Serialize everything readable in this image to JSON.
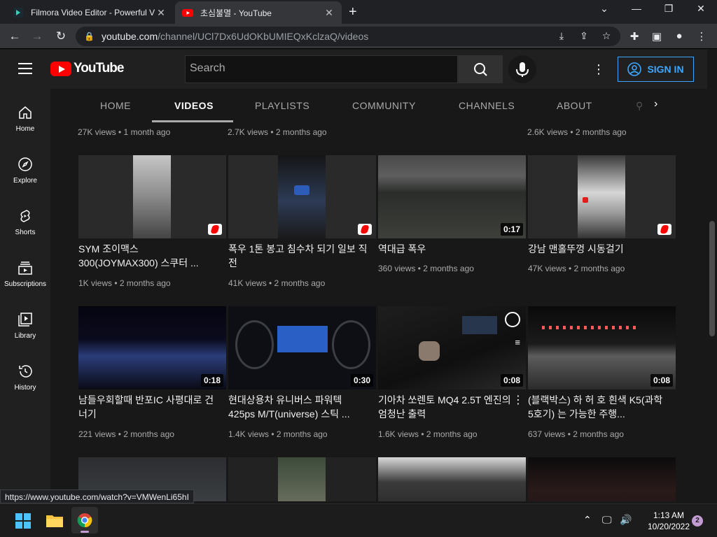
{
  "browser": {
    "tabs": [
      {
        "title": "Filmora Video Editor - Powerful V",
        "icon": "filmora-icon"
      },
      {
        "title": "초심불멸 - YouTube",
        "icon": "youtube-icon"
      }
    ],
    "url_host": "youtube.com",
    "url_path": "/channel/UCl7Dx6UdOKbUMIEQxKclzaQ/videos"
  },
  "header": {
    "logo_text": "YouTube",
    "search_placeholder": "Search",
    "signin_label": "SIGN IN"
  },
  "sidebar": {
    "items": [
      {
        "label": "Home",
        "icon": "home-icon"
      },
      {
        "label": "Explore",
        "icon": "compass-icon"
      },
      {
        "label": "Shorts",
        "icon": "shorts-icon"
      },
      {
        "label": "Subscriptions",
        "icon": "subscriptions-icon"
      },
      {
        "label": "Library",
        "icon": "library-icon"
      },
      {
        "label": "History",
        "icon": "history-icon"
      }
    ]
  },
  "channel_tabs": [
    "HOME",
    "VIDEOS",
    "PLAYLISTS",
    "COMMUNITY",
    "CHANNELS",
    "ABOUT"
  ],
  "top_meta": [
    "27K views • 1 month ago",
    "2.7K views • 2 months ago",
    "",
    "2.6K views • 2 months ago"
  ],
  "row1": [
    {
      "title": "SYM 조이맥스 300(JOYMAX300) 스쿠터 ...",
      "meta": "1K views • 2 months ago",
      "short": true,
      "duration": ""
    },
    {
      "title": "폭우 1톤 봉고 침수차 되기 일보 직전",
      "meta": "41K views • 2 months ago",
      "short": true,
      "duration": ""
    },
    {
      "title": "역대급 폭우",
      "meta": "360 views • 2 months ago",
      "short": false,
      "duration": "0:17"
    },
    {
      "title": "강남 맨홀뚜껑 시동걸기",
      "meta": "47K views • 2 months ago",
      "short": true,
      "duration": ""
    }
  ],
  "row2": [
    {
      "title": "남들우회할때 반포IC 사평대로 건너기",
      "meta": "221 views • 2 months ago",
      "duration": "0:18"
    },
    {
      "title": "현대상용차 유니버스 파워텍 425ps M/T(universe) 스틱 ...",
      "meta": "1.4K views • 2 months ago",
      "duration": "0:30"
    },
    {
      "title": "기아차 쏘렌토 MQ4 2.5T 엔진의 엄청난 출력",
      "meta": "1.6K views • 2 months ago",
      "duration": "0:08"
    },
    {
      "title": "(블랙박스) 하 허 호 흰색 K5(과학5호기) 는 가능한 주행...",
      "meta": "637 views • 2 months ago",
      "duration": "0:08"
    }
  ],
  "status_url": "https://www.youtube.com/watch?v=VMWenLi65hI",
  "taskbar": {
    "time": "1:13 AM",
    "date": "10/20/2022",
    "notifications": "2"
  }
}
